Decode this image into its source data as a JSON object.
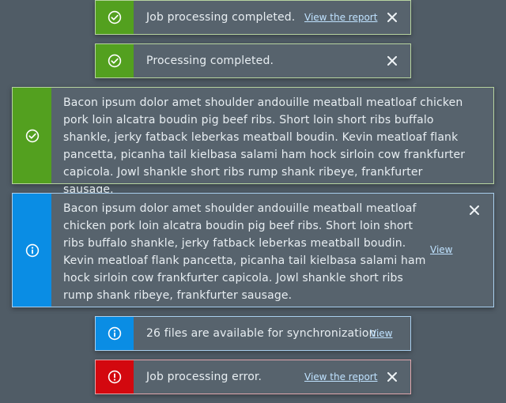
{
  "colors": {
    "background": "#505c66",
    "toast_bg": "#57636d",
    "success": "#53a01f",
    "info": "#0a8de4",
    "error": "#d3080f",
    "link": "#bfe2ff"
  },
  "toasts": [
    {
      "type": "success",
      "icon": "check-circle-icon",
      "message": "Job processing completed.",
      "link": "View the report",
      "closable": true
    },
    {
      "type": "success",
      "icon": "check-circle-icon",
      "message": "Processing completed.",
      "closable": true
    },
    {
      "type": "success",
      "icon": "check-circle-icon",
      "message": "Bacon ipsum dolor amet shoulder andouille meatball meatloaf chicken pork loin alcatra boudin pig beef ribs. Short loin short ribs buffalo shankle, jerky fatback leberkas meatball boudin. Kevin meatloaf flank pancetta, picanha tail kielbasa salami ham hock sirloin cow frankfurter capicola. Jowl shankle short ribs rump shank ribeye, frankfurter sausage.",
      "closable": false
    },
    {
      "type": "info",
      "icon": "info-circle-icon",
      "message": "Bacon ipsum dolor amet shoulder andouille meatball meatloaf chicken pork loin alcatra boudin pig beef ribs. Short loin short ribs buffalo shankle, jerky fatback leberkas meatball boudin. Kevin meatloaf flank pancetta, picanha tail kielbasa salami ham hock sirloin cow frankfurter capicola. Jowl shankle short ribs rump shank ribeye, frankfurter sausage.",
      "link": "View",
      "closable": true
    },
    {
      "type": "info",
      "icon": "info-circle-icon",
      "message": "26 files are available for synchronization.",
      "link": "View",
      "closable": false
    },
    {
      "type": "error",
      "icon": "error-circle-icon",
      "message": "Job processing error.",
      "link": "View the report",
      "closable": true
    }
  ]
}
